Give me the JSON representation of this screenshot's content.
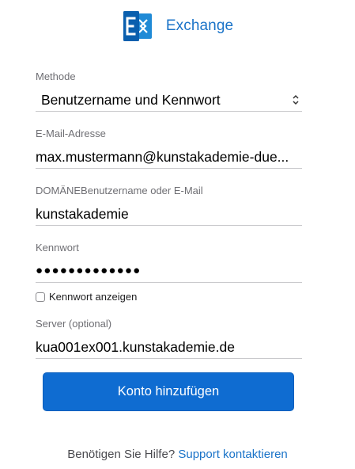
{
  "header": {
    "app_title": "Exchange",
    "logo_icon": "exchange-logo-icon",
    "brand_color": "#1a73c8"
  },
  "form": {
    "method": {
      "label": "Methode",
      "value": "Benutzername und Kennwort"
    },
    "email": {
      "label": "E-Mail-Adresse",
      "value": "max.mustermann@kunstakademie-duesseldorf.de",
      "display_value": "max.mustermann@kunstakademie-due..."
    },
    "username": {
      "label": "DOMÄNEBenutzername oder E-Mail",
      "value": "kunstakademie"
    },
    "password": {
      "label": "Kennwort",
      "masked_value": "●●●●●●●●●●●●●"
    },
    "show_password": {
      "label": "Kennwort anzeigen",
      "checked": false
    },
    "server": {
      "label": "Server (optional)",
      "value": "kua001ex001.kunstakademie.de"
    }
  },
  "actions": {
    "add_account_label": "Konto hinzufügen",
    "button_color": "#0f6cd1"
  },
  "help": {
    "text": "Benötigen Sie Hilfe?",
    "link_label": "Support kontaktieren"
  }
}
